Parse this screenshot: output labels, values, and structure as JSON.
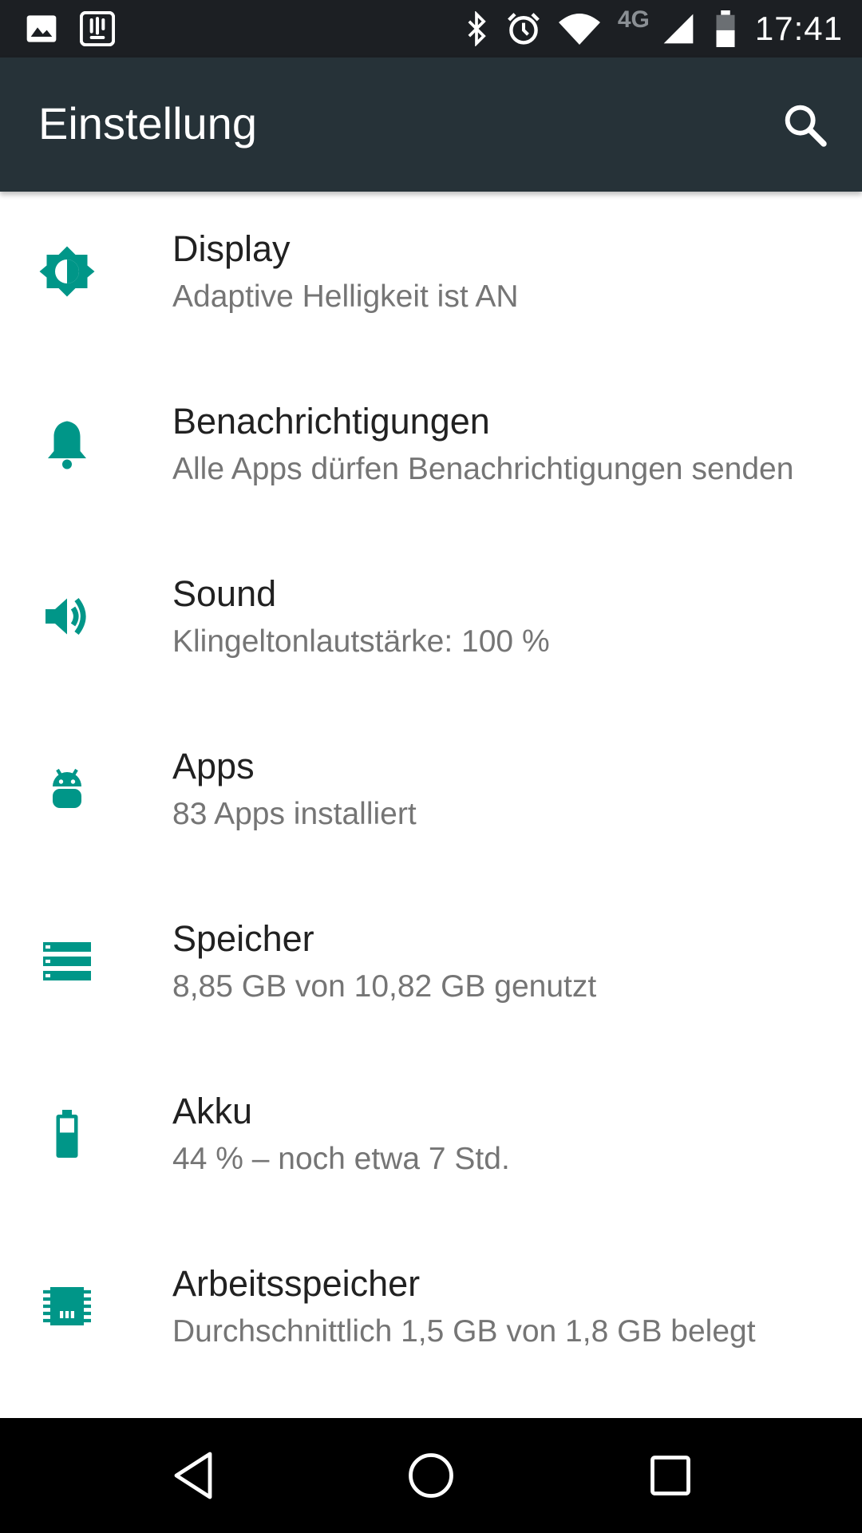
{
  "status_bar": {
    "network_type": "4G",
    "time": "17:41",
    "icons": [
      "image-icon",
      "clipboard-icon",
      "bluetooth-icon",
      "alarm-icon",
      "wifi-icon",
      "cell-signal-icon",
      "battery-icon"
    ]
  },
  "app_bar": {
    "title": "Einstellung",
    "search_icon": "search-icon"
  },
  "colors": {
    "accent": "#009688",
    "app_bar": "#263238",
    "status_bar": "#1c1f23",
    "title_text": "#212121",
    "subtitle_text": "#757575"
  },
  "settings": [
    {
      "icon": "brightness-icon",
      "title": "Display",
      "subtitle": "Adaptive Helligkeit ist AN"
    },
    {
      "icon": "bell-icon",
      "title": "Benachrichtigungen",
      "subtitle": "Alle Apps dürfen Benachrichtigungen senden"
    },
    {
      "icon": "volume-icon",
      "title": "Sound",
      "subtitle": "Klingeltonlautstärke: 100 %"
    },
    {
      "icon": "android-icon",
      "title": "Apps",
      "subtitle": "83 Apps installiert"
    },
    {
      "icon": "storage-icon",
      "title": "Speicher",
      "subtitle": "8,85 GB von 10,82 GB genutzt"
    },
    {
      "icon": "battery-icon",
      "title": "Akku",
      "subtitle": "44 % – noch etwa 7 Std."
    },
    {
      "icon": "memory-icon",
      "title": "Arbeitsspeicher",
      "subtitle": "Durchschnittlich 1,5 GB von 1,8 GB belegt"
    }
  ],
  "nav_bar": {
    "icons": [
      "back-icon",
      "home-icon",
      "recents-icon"
    ]
  }
}
